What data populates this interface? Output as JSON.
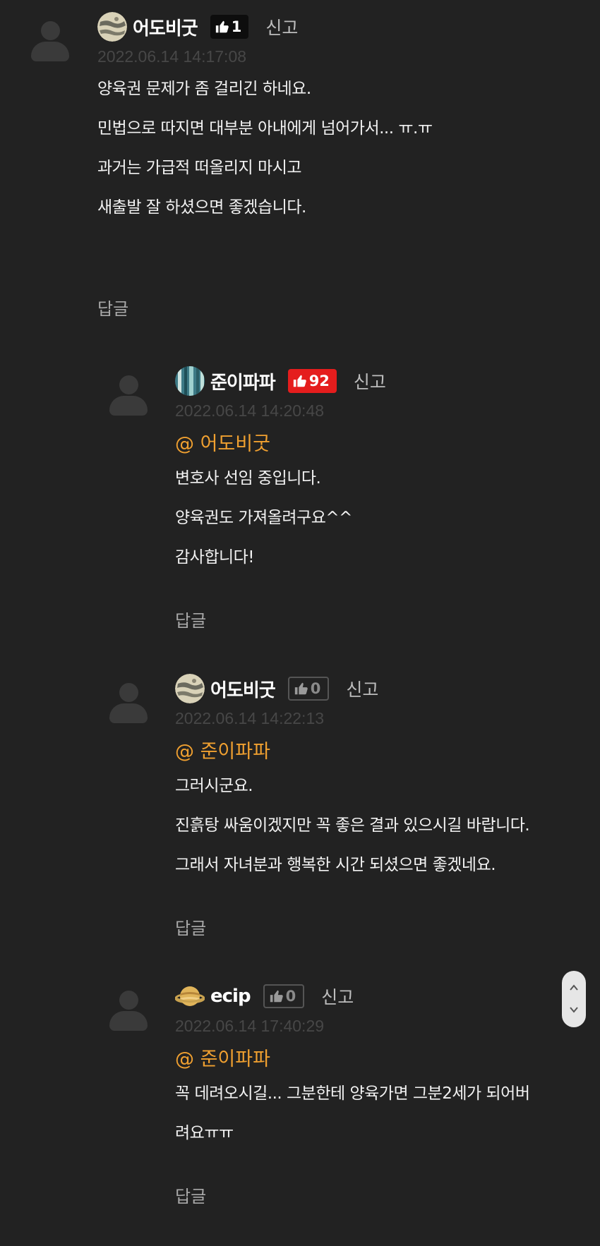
{
  "comments": [
    {
      "nickname": "어도비굿",
      "likes": "1",
      "report": "신고",
      "timestamp": "2022.06.14 14:17:08",
      "mention": "",
      "lines": [
        "양육권 문제가 좀 걸리긴 하네요.",
        "민법으로 따지면 대부분 아내에게 넘어가서... ㅠ.ㅠ",
        "과거는 가급적 떠올리지 마시고",
        "새출발 잘 하셨으면 좋겠습니다."
      ],
      "reply": "답글",
      "avatar_icon": "moon-avatar-icon",
      "like_style": "dark"
    },
    {
      "nickname": "준이파파",
      "likes": "92",
      "report": "신고",
      "timestamp": "2022.06.14 14:20:48",
      "mention": "@ 어도비굿",
      "lines": [
        "변호사 선임 중입니다.",
        "양육권도 가져올려구요^^",
        "감사합니다!"
      ],
      "reply": "답글",
      "avatar_icon": "waterfall-avatar-icon",
      "like_style": "red"
    },
    {
      "nickname": "어도비굿",
      "likes": "0",
      "report": "신고",
      "timestamp": "2022.06.14 14:22:13",
      "mention": "@ 준이파파",
      "lines": [
        "그러시군요.",
        "진흙탕 싸움이겠지만 꼭 좋은 결과 있으시길 바랍니다.",
        "그래서 자녀분과 행복한 시간 되셨으면 좋겠네요."
      ],
      "reply": "답글",
      "avatar_icon": "moon-avatar-icon",
      "like_style": "outline"
    },
    {
      "nickname": "ecip",
      "likes": "0",
      "report": "신고",
      "timestamp": "2022.06.14 17:40:29",
      "mention": "@ 준이파파",
      "lines": [
        "꼭 데려오시길... 그분한테 양육가면 그분2세가 되어버",
        "려요ㅠㅠ"
      ],
      "reply": "답글",
      "avatar_icon": "planet-avatar-icon",
      "like_style": "outline"
    }
  ],
  "colors": {
    "background": "#222222",
    "mention": "#f0a030",
    "like_red": "#e51d1d",
    "timestamp": "#474747"
  }
}
